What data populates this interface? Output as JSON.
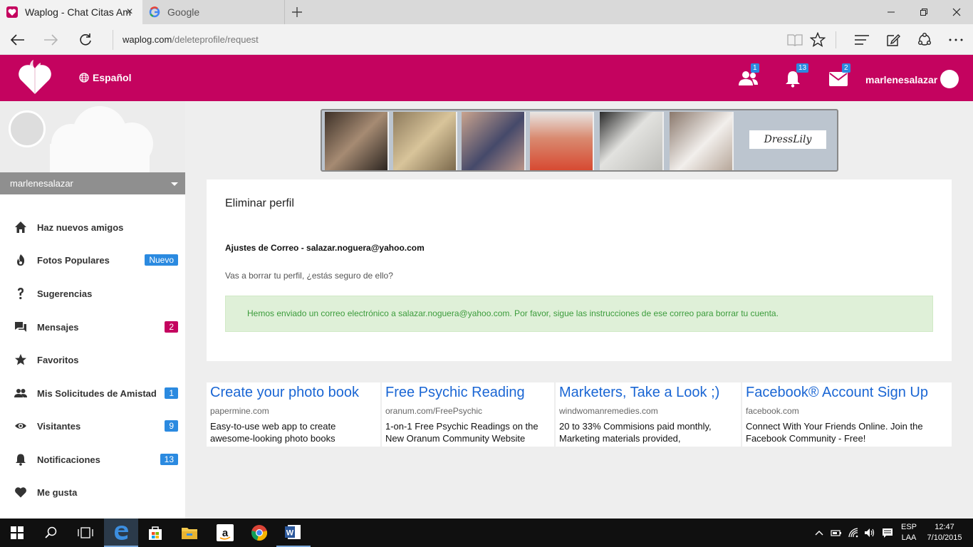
{
  "browser": {
    "tabs": [
      {
        "title": "Waplog - Chat Citas Am",
        "close": "×"
      },
      {
        "title": "Google"
      }
    ],
    "url_host": "waplog.com",
    "url_path": "/deleteprofile/request"
  },
  "header": {
    "language": "Español",
    "friends_count": "1",
    "notifications_count": "13",
    "messages_count": "2",
    "username": "marlenesalazar",
    "brand_color": "#c4035f"
  },
  "sidebar": {
    "username": "marlenesalazar",
    "items": [
      {
        "label": "Haz nuevos amigos",
        "icon": "home-icon"
      },
      {
        "label": "Fotos Populares",
        "icon": "fire-icon",
        "badge": "Nuevo",
        "badge_color": "#2b8ae0"
      },
      {
        "label": "Sugerencias",
        "icon": "question-icon"
      },
      {
        "label": "Mensajes",
        "icon": "chat-icon",
        "badge": "2",
        "badge_color": "#c4035f"
      },
      {
        "label": "Favoritos",
        "icon": "star-icon"
      },
      {
        "label": "Mis Solicitudes de Amistad",
        "icon": "people-icon",
        "badge": "1",
        "badge_color": "#2b8ae0"
      },
      {
        "label": "Visitantes",
        "icon": "eye-icon",
        "badge": "9",
        "badge_color": "#2b8ae0"
      },
      {
        "label": "Notificaciones",
        "icon": "bell-icon",
        "badge": "13",
        "badge_color": "#2b8ae0"
      },
      {
        "label": "Me gusta",
        "icon": "heart-icon"
      }
    ]
  },
  "banner": {
    "brand": "DressLily"
  },
  "main": {
    "title": "Eliminar perfil",
    "mail_settings": "Ajustes de Correo - salazar.noguera@yahoo.com",
    "confirm": "Vas a borrar tu perfil, ¿estás seguro de ello?",
    "alert": "Hemos enviado un correo electrónico a salazar.noguera@yahoo.com. Por favor, sigue las instrucciones de ese correo para borrar tu cuenta."
  },
  "ads": [
    {
      "title": "Create your photo book",
      "url": "papermine.com",
      "desc": "Easy-to-use web app to create awesome-looking photo books"
    },
    {
      "title": "Free Psychic Reading",
      "url": "oranum.com/FreePsychic",
      "desc": "1-on-1 Free Psychic Readings on the New Oranum Community Website"
    },
    {
      "title": "Marketers, Take a Look ;)",
      "url": "windwomanremedies.com",
      "desc": "20 to 33% Commisions paid monthly, Marketing materials provided,"
    },
    {
      "title": "Facebook® Account Sign Up",
      "url": "facebook.com",
      "desc": "Connect With Your Friends Online. Join the Facebook Community - Free!"
    }
  ],
  "taskbar": {
    "language_line1": "ESP",
    "language_line2": "LAA",
    "time": "12:47",
    "date": "7/10/2015"
  }
}
